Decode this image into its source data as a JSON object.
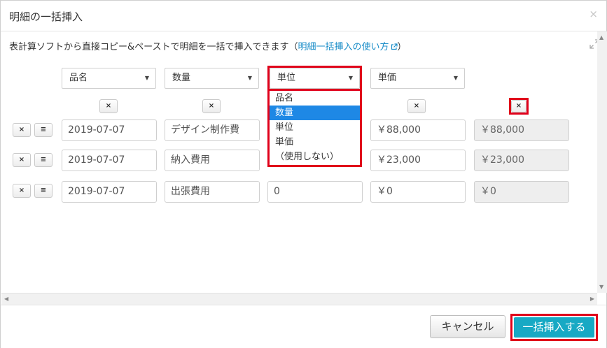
{
  "dialog": {
    "title": "明細の一括挿入",
    "close": "×"
  },
  "description": {
    "text": "表計算ソフトから直接コピー&ペーストで明細を一括で挿入できます（",
    "link": "明細一括挿入の使い方",
    "suffix": "）"
  },
  "columns": [
    {
      "select_label": "品名"
    },
    {
      "select_label": "数量"
    },
    {
      "select_label": "単位"
    },
    {
      "select_label": "単価"
    }
  ],
  "column_remove_label": "×",
  "dropdown": {
    "options": [
      "品名",
      "数量",
      "単位",
      "単価",
      "（使用しない）"
    ],
    "highlighted": "数量"
  },
  "row_buttons": {
    "remove": "×",
    "menu": "≡"
  },
  "rows": [
    {
      "c1": "2019-07-07",
      "c2": "デザイン制作費",
      "c3": "",
      "c4": "￥88,000",
      "c5": "￥88,000"
    },
    {
      "c1": "2019-07-07",
      "c2": "納入費用",
      "c3": "",
      "c4": "￥23,000",
      "c5": "￥23,000"
    },
    {
      "c1": "2019-07-07",
      "c2": "出張費用",
      "c3": "0",
      "c4": "￥0",
      "c5": "￥0"
    }
  ],
  "footer": {
    "cancel": "キャンセル",
    "insert": "一括挿入する"
  },
  "colors": {
    "accent": "#17a9c4",
    "highlight": "#e0001a",
    "link": "#1a8dc8",
    "selected": "#1e88e5"
  }
}
